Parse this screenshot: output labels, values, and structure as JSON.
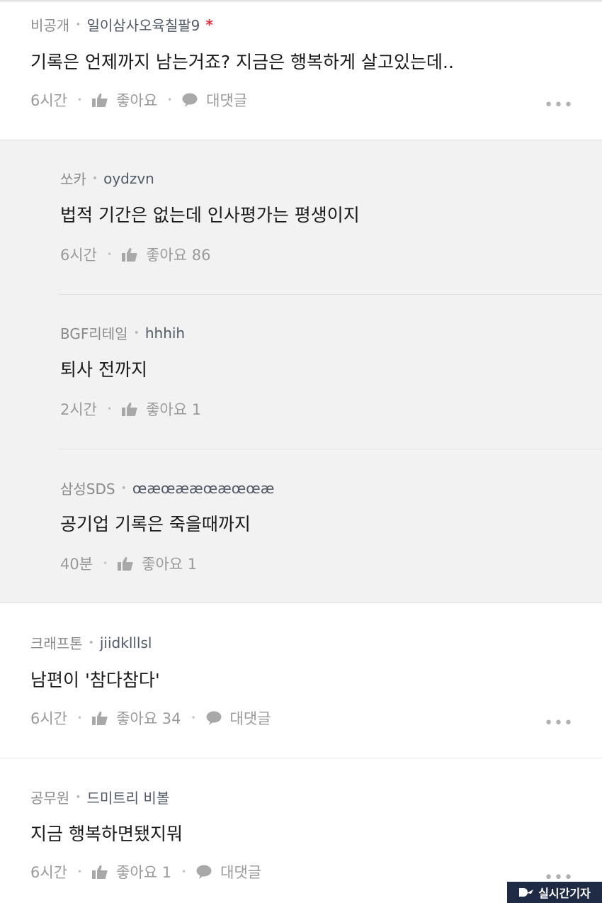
{
  "comments": [
    {
      "company": "비공개",
      "nickname": "일이삼사오육칠팔9",
      "author_marker": "*",
      "text": "기록은 언제까지 남는거죠? 지금은 행복하게 살고있는데..",
      "time": "6시간",
      "like_label": "좋아요",
      "reply_label": "대댓글",
      "more_label": "•••"
    },
    {
      "company": "크래프톤",
      "nickname": "jiidklllsl",
      "text": "남편이 '참다참다'",
      "time": "6시간",
      "like_label": "좋아요 34",
      "reply_label": "대댓글",
      "more_label": "•••"
    },
    {
      "company": "공무원",
      "nickname": "드미트리 비볼",
      "text": "지금 행복하면됐지뭐",
      "time": "6시간",
      "like_label": "좋아요 1",
      "reply_label": "대댓글",
      "more_label": "•••"
    }
  ],
  "replies": [
    {
      "company": "쏘카",
      "nickname": "oydzvn",
      "text": "법적 기간은 없는데 인사평가는 평생이지",
      "time": "6시간",
      "like_label": "좋아요 86"
    },
    {
      "company": "BGF리테일",
      "nickname": "hhhih",
      "text": "퇴사 전까지",
      "time": "2시간",
      "like_label": "좋아요 1"
    },
    {
      "company": "삼성SDS",
      "nickname": "œæœææœæœœæ",
      "text": "공기업 기록은 죽을때까지",
      "time": "40분",
      "like_label": "좋아요 1"
    }
  ],
  "separator": "•",
  "watermark": "실시간기자",
  "colors": {
    "reply_bg": "#f2f2f3",
    "author_marker": "#e0313a",
    "watermark_bg": "#1f2a44"
  },
  "icons": {
    "like": "thumbs-up-icon",
    "reply": "speech-bubble-icon",
    "more": "more-dots-icon"
  }
}
